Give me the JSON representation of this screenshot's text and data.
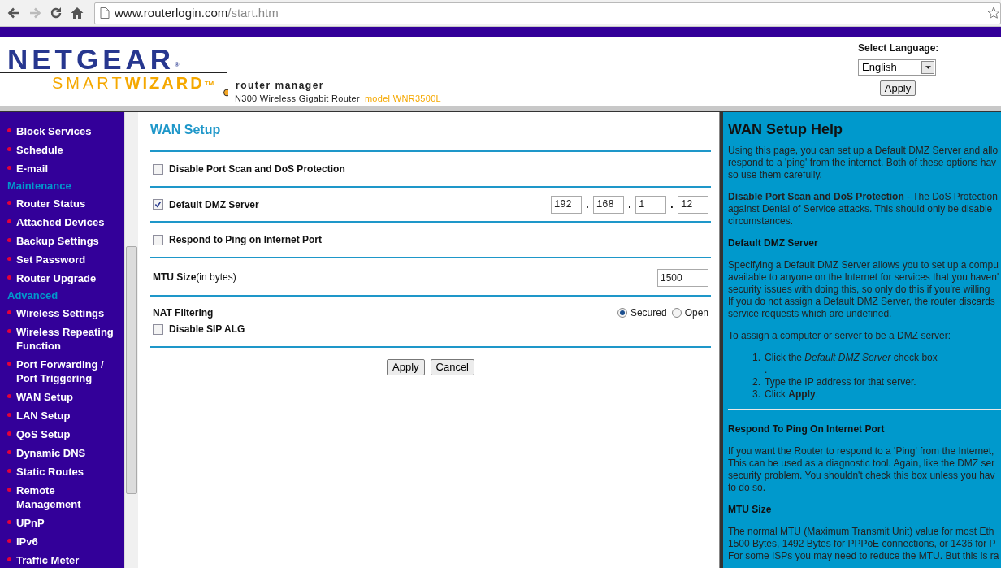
{
  "browser": {
    "url_host": "www.routerlogin.com",
    "url_path": "/start.htm"
  },
  "header": {
    "brand": "NETGEAR",
    "brand_mark": "®",
    "product_light": "SMART",
    "product_bold": "WIZARD",
    "product_mark": "TM",
    "subtitle": "router manager",
    "router_name": "N300 Wireless Gigabit Router",
    "model": "model WNR3500L",
    "language_label": "Select Language:",
    "language": "English",
    "apply": "Apply"
  },
  "sidebar": {
    "items": [
      {
        "kind": "link",
        "label": "Block Services",
        "selected": false
      },
      {
        "kind": "link",
        "label": "Schedule",
        "selected": false
      },
      {
        "kind": "link",
        "label": "E-mail",
        "selected": false
      },
      {
        "kind": "heading",
        "label": "Maintenance"
      },
      {
        "kind": "link",
        "label": "Router Status",
        "selected": false
      },
      {
        "kind": "link",
        "label": "Attached Devices",
        "selected": false
      },
      {
        "kind": "link",
        "label": "Backup Settings",
        "selected": false
      },
      {
        "kind": "link",
        "label": "Set Password",
        "selected": false
      },
      {
        "kind": "link",
        "label": "Router Upgrade",
        "selected": false
      },
      {
        "kind": "heading",
        "label": "Advanced"
      },
      {
        "kind": "link",
        "label": "Wireless Settings",
        "selected": false
      },
      {
        "kind": "link",
        "label": "Wireless Repeating Function",
        "selected": false
      },
      {
        "kind": "link",
        "label": "Port Forwarding / Port Triggering",
        "selected": false
      },
      {
        "kind": "link",
        "label": "WAN Setup",
        "selected": false
      },
      {
        "kind": "link",
        "label": "LAN Setup",
        "selected": false
      },
      {
        "kind": "link",
        "label": "QoS Setup",
        "selected": false
      },
      {
        "kind": "link",
        "label": "Dynamic DNS",
        "selected": false
      },
      {
        "kind": "link",
        "label": "Static Routes",
        "selected": false
      },
      {
        "kind": "link",
        "label": "Remote Management",
        "selected": false
      },
      {
        "kind": "link",
        "label": "UPnP",
        "selected": false
      },
      {
        "kind": "link",
        "label": "IPv6",
        "selected": false
      },
      {
        "kind": "link",
        "label": "Traffic Meter",
        "selected": false
      }
    ]
  },
  "main": {
    "title": "WAN Setup",
    "sections": [
      {
        "kind": "checkbox",
        "label": "Disable Port Scan and DoS Protection",
        "checked": false
      },
      {
        "kind": "ip",
        "label": "Default DMZ Server",
        "checked": true,
        "separator": ".",
        "octets": [
          "192",
          "168",
          "1",
          "12"
        ]
      },
      {
        "kind": "checkbox",
        "label": "Respond to Ping on Internet Port",
        "checked": false
      },
      {
        "kind": "mtu",
        "label": "MTU Size",
        "unit": "(in bytes)",
        "value": "1500"
      },
      {
        "kind": "nat",
        "label": "NAT Filtering",
        "options": [
          {
            "label": "Secured",
            "selected": true
          },
          {
            "label": "Open",
            "selected": false
          }
        ],
        "sub_label": "Disable SIP ALG",
        "checked": false
      }
    ],
    "buttons": [
      "Apply",
      "Cancel"
    ]
  },
  "help": {
    "title": "WAN Setup Help",
    "blocks": [
      {
        "kind": "para",
        "lines": [
          "Using this page, you can set up a Default DMZ Server and allo",
          "respond to a 'ping' from the internet. Both of these options hav",
          "so use them carefully."
        ]
      },
      {
        "kind": "para",
        "lines": [
          "**Disable Port Scan and DoS Protection** - The DoS Protection",
          "against Denial of Service attacks. This should only be disable",
          "circumstances."
        ]
      },
      {
        "kind": "heading",
        "text": "Default DMZ Server"
      },
      {
        "kind": "para",
        "lines": [
          "Specifying a Default DMZ Server allows you to set up a compu",
          "available to anyone on the Internet for services that you haven'",
          "security issues with doing this, so only do this if you're willing",
          "If you do not assign a Default DMZ Server, the router discards",
          "service requests which are undefined."
        ]
      },
      {
        "kind": "para",
        "lines": [
          "To assign a computer or server to be a DMZ server:"
        ]
      },
      {
        "kind": "steps",
        "items": [
          {
            "number": "1.",
            "lines": [
              "Click the *Default DMZ Server* check box",
              "."
            ]
          },
          {
            "number": "2.",
            "lines": [
              "Type the IP address for that server."
            ]
          },
          {
            "number": "3.",
            "lines": [
              "Click **Apply**."
            ]
          }
        ]
      },
      {
        "kind": "rule"
      },
      {
        "kind": "heading",
        "text": "Respond To Ping On Internet Port"
      },
      {
        "kind": "para",
        "lines": [
          "If you want the Router to respond to a 'Ping' from the Internet,",
          "This can be used as a diagnostic tool. Again, like the DMZ ser",
          "security problem. You shouldn't check this box unless you hav",
          "to do so."
        ]
      },
      {
        "kind": "heading",
        "text": "MTU Size"
      },
      {
        "kind": "para",
        "lines": [
          "The normal MTU (Maximum Transmit Unit) value for most Eth",
          "1500 Bytes, 1492 Bytes for PPPoE connections, or 1436 for P",
          "For some ISPs you may need to reduce the MTU. But this is ra"
        ]
      }
    ]
  }
}
